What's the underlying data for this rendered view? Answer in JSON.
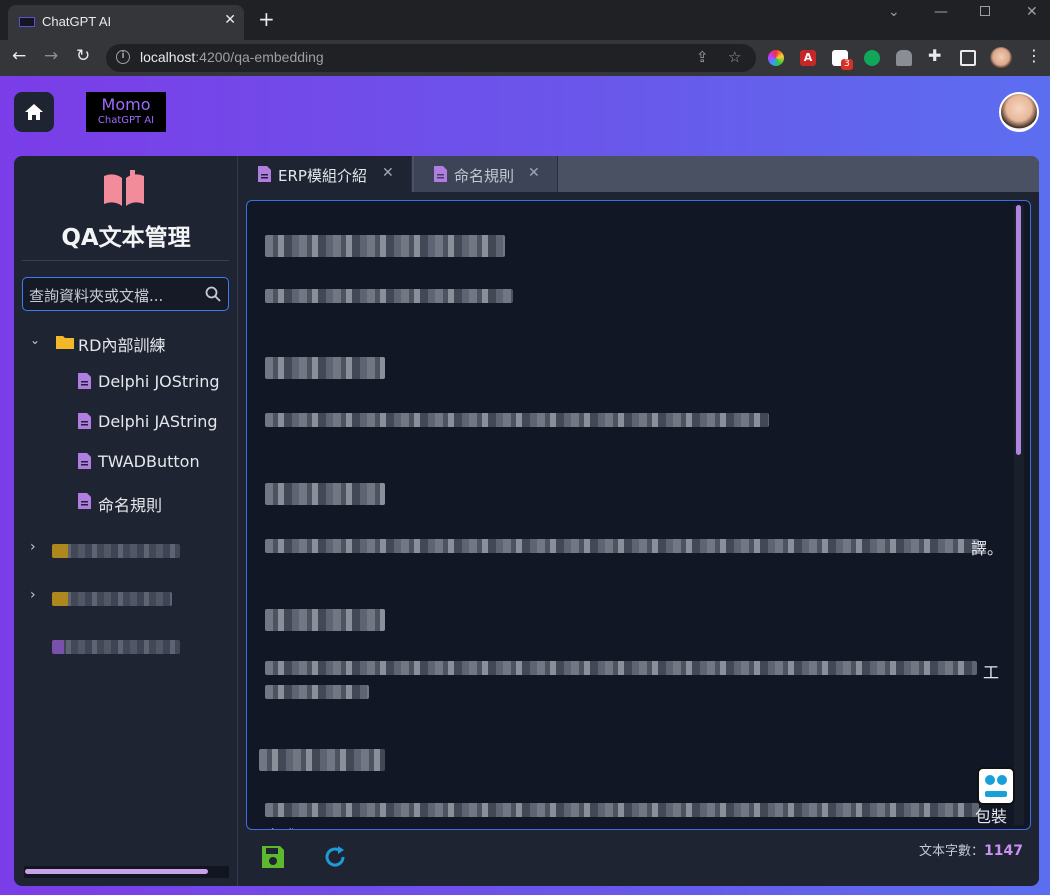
{
  "browser": {
    "tab_title": "ChatGPT AI",
    "url_host": "localhost",
    "url_rest": ":4200/qa-embedding",
    "extension_badge": "3"
  },
  "header": {
    "logo_line1": "Momo",
    "logo_line2": "ChatGPT AI"
  },
  "sidebar": {
    "title": "QA文本管理",
    "search_placeholder": "查詢資料夾或文檔...",
    "folder": {
      "label": "RD內部訓練",
      "items": [
        {
          "label": "Delphi JOString"
        },
        {
          "label": "Delphi JAString"
        },
        {
          "label": "TWADButton"
        },
        {
          "label": "命名規則"
        }
      ]
    }
  },
  "tabs": [
    {
      "label": "ERP模組介紹",
      "active": true
    },
    {
      "label": "命名規則",
      "active": false
    }
  ],
  "editor": {
    "tail_1": "譯。",
    "tail_2": "工",
    "tail_3": "包裝",
    "tail_4": "文成"
  },
  "footer": {
    "count_label": "文本字數：",
    "count_value": "1147"
  },
  "colors": {
    "accent_purple": "#c990ef",
    "folder_yellow": "#f2b82a",
    "doc_purple": "#b07ee0",
    "save_green": "#5cb82c",
    "refresh_blue": "#1e9ad6"
  }
}
